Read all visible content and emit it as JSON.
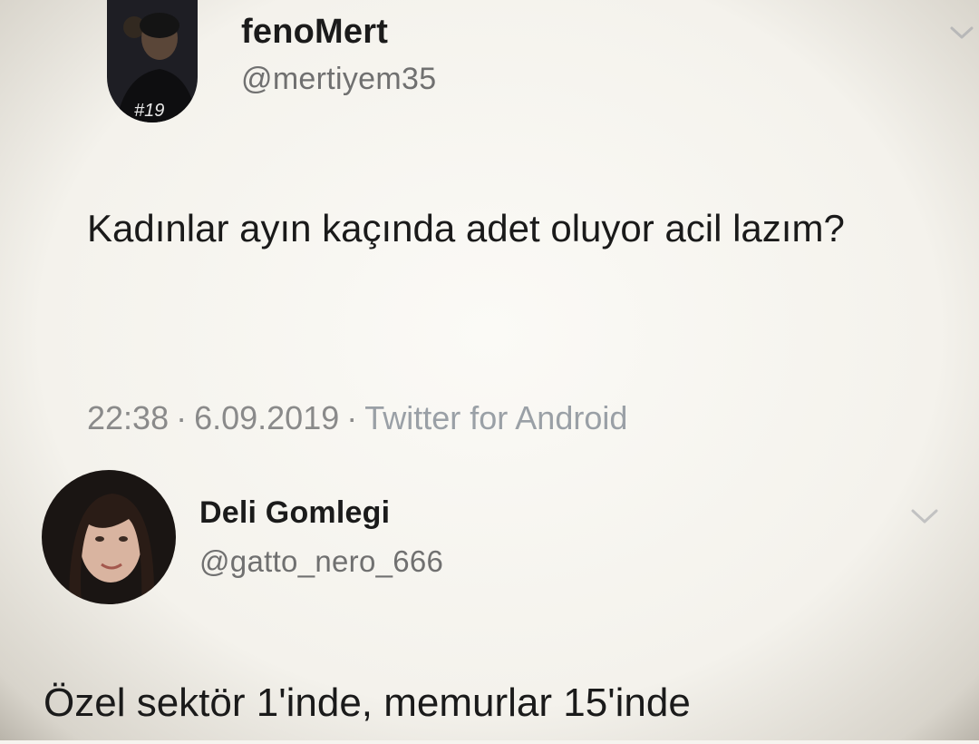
{
  "tweets": [
    {
      "display_name": "fenoMert",
      "handle": "@mertiyem35",
      "text": "Kadınlar ayın kaçında adet oluyor acil lazım?",
      "time": "22:38",
      "date": "6.09.2019",
      "source": "Twitter for Android",
      "separator": "·",
      "avatar_icon": "user-photo-icon",
      "menu_icon": "chevron-down-icon"
    },
    {
      "display_name": "Deli Gomlegi",
      "handle": "@gatto_nero_666",
      "text": "Özel sektör 1'inde, memurlar 15'inde",
      "avatar_icon": "user-photo-icon",
      "menu_icon": "chevron-down-icon"
    }
  ],
  "colors": {
    "background": "#f6f4ef",
    "name": "#1b1b1b",
    "handle": "#707070",
    "meta": "#8a8a8a",
    "chevron": "#b8b8b8"
  }
}
